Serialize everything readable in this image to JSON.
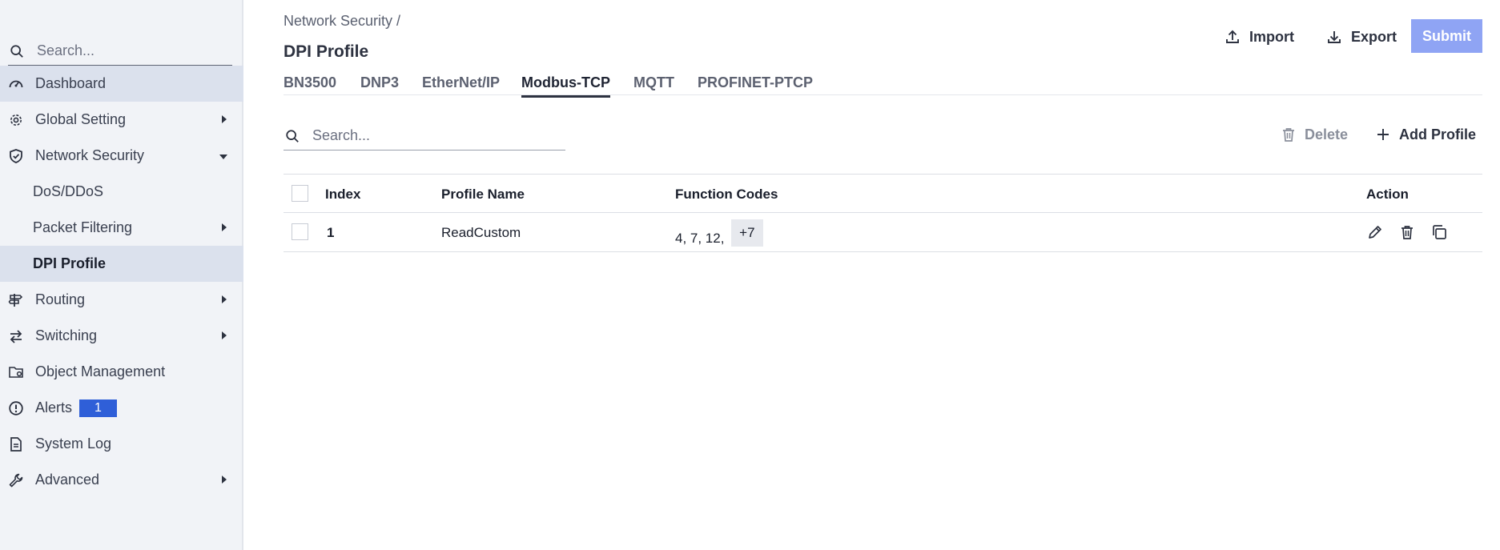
{
  "sidebar": {
    "search_placeholder": "Search...",
    "items": [
      {
        "label": "Dashboard",
        "icon": "dashboard-icon"
      },
      {
        "label": "Global Setting",
        "icon": "gear-icon"
      },
      {
        "label": "Network Security",
        "icon": "shield-icon"
      },
      {
        "label": "DoS/DDoS"
      },
      {
        "label": "Packet Filtering"
      },
      {
        "label": "DPI Profile"
      },
      {
        "label": "Routing",
        "icon": "signpost-icon"
      },
      {
        "label": "Switching",
        "icon": "switch-arrows-icon"
      },
      {
        "label": "Object Management",
        "icon": "folder-gear-icon"
      },
      {
        "label": "Alerts",
        "icon": "alert-circle-icon",
        "badge": "1"
      },
      {
        "label": "System Log",
        "icon": "log-file-icon"
      },
      {
        "label": "Advanced",
        "icon": "wrench-icon"
      }
    ]
  },
  "header": {
    "breadcrumb": "Network Security /",
    "title": "DPI Profile",
    "import_label": "Import",
    "export_label": "Export",
    "submit_label": "Submit"
  },
  "tabs": [
    "BN3500",
    "DNP3",
    "EtherNet/IP",
    "Modbus-TCP",
    "MQTT",
    "PROFINET-PTCP"
  ],
  "active_tab": "Modbus-TCP",
  "toolbar": {
    "search_placeholder": "Search...",
    "delete_label": "Delete",
    "add_label": "Add Profile"
  },
  "table": {
    "columns": [
      "Index",
      "Profile Name",
      "Function Codes",
      "Action"
    ],
    "rows": [
      {
        "index": "1",
        "profile_name": "ReadCustom",
        "function_codes": "4, 7, 12,",
        "more": "+7"
      }
    ]
  },
  "colors": {
    "accent": "#2f5fd8",
    "submit_disabled": "#8fa4f4",
    "sidebar_bg": "#f1f3f7",
    "active_item_bg": "#dbe1ed"
  }
}
